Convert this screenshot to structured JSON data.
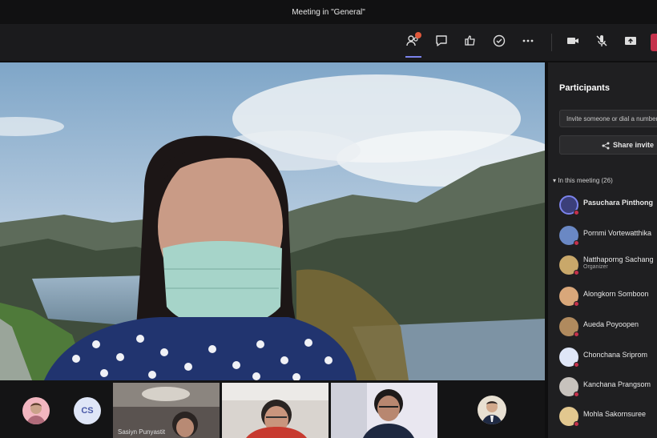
{
  "window": {
    "title": "Meeting in \"General\""
  },
  "toolbar": {
    "buttons": [
      {
        "icon": "participants-icon",
        "active": true
      },
      {
        "icon": "chat-icon"
      },
      {
        "icon": "reactions-icon"
      },
      {
        "icon": "breakout-rooms-icon"
      },
      {
        "icon": "more-options-icon"
      },
      {
        "icon": "camera-icon"
      },
      {
        "icon": "microphone-icon"
      },
      {
        "icon": "share-tray-icon"
      }
    ],
    "accent": "#7b83eb"
  },
  "strip": {
    "avatars": [
      {
        "initials": "",
        "color": "#f2b6c0"
      },
      {
        "initials": "CS",
        "color": "#dfe6f7"
      },
      {
        "initials": "",
        "color": "#e8e0d2"
      }
    ],
    "thumbnails": [
      {
        "name": "Sasiyn Punyastit"
      },
      {
        "name": ""
      },
      {
        "name": ""
      }
    ]
  },
  "participants": {
    "title": "Participants",
    "invite_placeholder": "Invite someone or dial a number",
    "share_label": "Share invite",
    "section_label": "In this meeting (26)",
    "people": [
      {
        "name": "Pasuchara Pinthong",
        "role": "",
        "color": "#3b3f7a",
        "presenter": true
      },
      {
        "name": "Pornmi Vortewatthika",
        "role": "",
        "color": "#6a88c4"
      },
      {
        "name": "Natthaporng Sachang",
        "role": "Organizer",
        "color": "#c9a86a"
      },
      {
        "name": "Alongkorn Somboon",
        "role": "",
        "color": "#d9a77a"
      },
      {
        "name": "Aueda Poyoopen",
        "role": "",
        "color": "#b08a5e"
      },
      {
        "name": "Chonchana Sriprom",
        "role": "",
        "color": "#dfe6f7"
      },
      {
        "name": "Kanchana Prangsom",
        "role": "",
        "color": "#c7c2bd"
      },
      {
        "name": "Mohla Sakornsuree",
        "role": "",
        "color": "#e2c78f"
      }
    ]
  }
}
